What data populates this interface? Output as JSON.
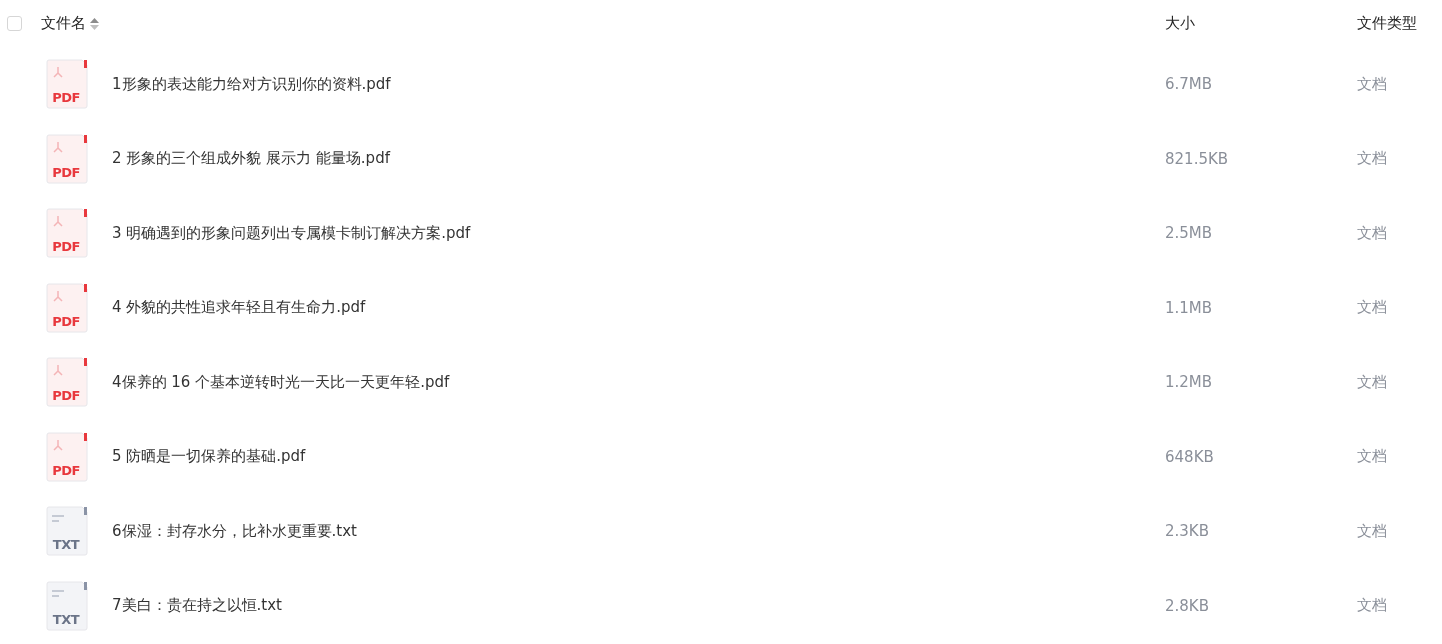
{
  "header": {
    "select_all": {
      "checked": false
    },
    "columns": [
      "文件名",
      "大小",
      "文件类型"
    ]
  },
  "rows": [
    {
      "kind": "pdf",
      "icon_label": "PDF",
      "name": "1形象的表达能力给对方识别你的资料.pdf",
      "size": "6.7MB",
      "type": "文档"
    },
    {
      "kind": "pdf",
      "icon_label": "PDF",
      "name": "2 形象的三个组成外貌  展示力  能量场.pdf",
      "size": "821.5KB",
      "type": "文档"
    },
    {
      "kind": "pdf",
      "icon_label": "PDF",
      "name": "3 明确遇到的形象问题列出专属模卡制订解决方案.pdf",
      "size": "2.5MB",
      "type": "文档"
    },
    {
      "kind": "pdf",
      "icon_label": "PDF",
      "name": "4 外貌的共性追求年轻且有生命力.pdf",
      "size": "1.1MB",
      "type": "文档"
    },
    {
      "kind": "pdf",
      "icon_label": "PDF",
      "name": "4保养的 16 个基本逆转时光一天比一天更年轻.pdf",
      "size": "1.2MB",
      "type": "文档"
    },
    {
      "kind": "pdf",
      "icon_label": "PDF",
      "name": "5 防晒是一切保养的基础.pdf",
      "size": "648KB",
      "type": "文档"
    },
    {
      "kind": "txt",
      "icon_label": "TXT",
      "name": "6保湿：封存水分，比补水更重要.txt",
      "size": "2.3KB",
      "type": "文档"
    },
    {
      "kind": "txt",
      "icon_label": "TXT",
      "name": "7美白：贵在持之以恒.txt",
      "size": "2.8KB",
      "type": "文档"
    }
  ]
}
